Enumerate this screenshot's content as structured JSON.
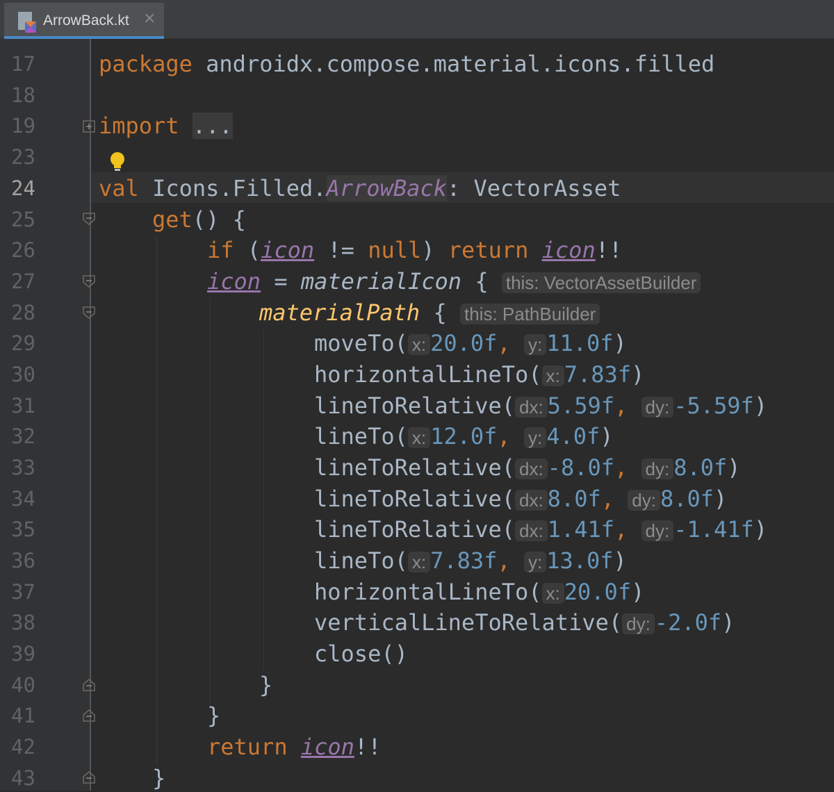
{
  "tab": {
    "filename": "ArrowBack.kt",
    "close_glyph": "×",
    "icon": "kotlin-file-icon"
  },
  "colors": {
    "keyword": "#cc7832",
    "function": "#ffc66d",
    "number": "#6897bb",
    "property": "#9876aa",
    "default": "#a9b7c6",
    "hint_bg": "#3b3b3b"
  },
  "lines": [
    {
      "no": "17",
      "t": {
        "kw": "package",
        "rest": " androidx.compose.material.icons.filled"
      }
    },
    {
      "no": "18"
    },
    {
      "no": "19",
      "t": {
        "kw": "import",
        "fold": "..."
      }
    },
    {
      "no": "23"
    },
    {
      "no": "24",
      "t": {
        "kw": "val",
        "a": " Icons.Filled.",
        "prop": "ArrowBack",
        "b": ": VectorAsset"
      }
    },
    {
      "no": "25",
      "t": {
        "fn": "get",
        "rest": "() {"
      }
    },
    {
      "no": "26",
      "t": {
        "kw1": "if",
        "a": " (",
        "prop1": "icon",
        "b": " != ",
        "kw2": "null",
        "c": ") ",
        "kw3": "return",
        "d": " ",
        "prop2": "icon",
        "e": "!!"
      }
    },
    {
      "no": "27",
      "t": {
        "prop": "icon",
        "a": " = ",
        "fn": "materialIcon",
        "b": " {",
        "hint": "this: VectorAssetBuilder"
      }
    },
    {
      "no": "28",
      "t": {
        "fn": "materialPath",
        "b": " {",
        "hint": "this: PathBuilder"
      }
    },
    {
      "no": "29",
      "t": {
        "name": "moveTo(",
        "h1": "x:",
        "v1": "20.0f",
        "sep": ",",
        "h2": "y:",
        "v2": "11.0f",
        "end": ")"
      }
    },
    {
      "no": "30",
      "t": {
        "name": "horizontalLineTo(",
        "h1": "x:",
        "v1": "7.83f",
        "end": ")"
      }
    },
    {
      "no": "31",
      "t": {
        "name": "lineToRelative(",
        "h1": "dx:",
        "v1": "5.59f",
        "sep": ",",
        "h2": "dy:",
        "v2": "-5.59f",
        "end": ")"
      }
    },
    {
      "no": "32",
      "t": {
        "name": "lineTo(",
        "h1": "x:",
        "v1": "12.0f",
        "sep": ",",
        "h2": "y:",
        "v2": "4.0f",
        "end": ")"
      }
    },
    {
      "no": "33",
      "t": {
        "name": "lineToRelative(",
        "h1": "dx:",
        "v1": "-8.0f",
        "sep": ",",
        "h2": "dy:",
        "v2": "8.0f",
        "end": ")"
      }
    },
    {
      "no": "34",
      "t": {
        "name": "lineToRelative(",
        "h1": "dx:",
        "v1": "8.0f",
        "sep": ",",
        "h2": "dy:",
        "v2": "8.0f",
        "end": ")"
      }
    },
    {
      "no": "35",
      "t": {
        "name": "lineToRelative(",
        "h1": "dx:",
        "v1": "1.41f",
        "sep": ",",
        "h2": "dy:",
        "v2": "-1.41f",
        "end": ")"
      }
    },
    {
      "no": "36",
      "t": {
        "name": "lineTo(",
        "h1": "x:",
        "v1": "7.83f",
        "sep": ",",
        "h2": "y:",
        "v2": "13.0f",
        "end": ")"
      }
    },
    {
      "no": "37",
      "t": {
        "name": "horizontalLineTo(",
        "h1": "x:",
        "v1": "20.0f",
        "end": ")"
      }
    },
    {
      "no": "38",
      "t": {
        "name": "verticalLineToRelative(",
        "h1": "dy:",
        "v1": "-2.0f",
        "end": ")"
      }
    },
    {
      "no": "39",
      "t": {
        "name": "close()"
      }
    },
    {
      "no": "40",
      "t": {
        "rest": "}"
      }
    },
    {
      "no": "41",
      "t": {
        "rest": "}"
      }
    },
    {
      "no": "42",
      "t": {
        "kw": "return",
        "a": " ",
        "prop": "icon",
        "b": "!!"
      }
    },
    {
      "no": "43",
      "t": {
        "rest": "}"
      }
    }
  ]
}
